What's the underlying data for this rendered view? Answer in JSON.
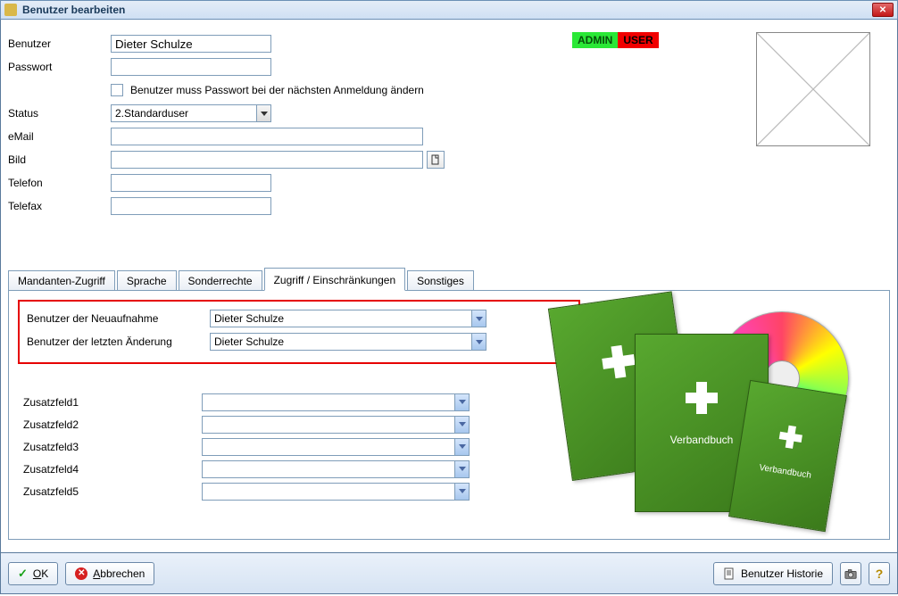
{
  "window": {
    "title": "Benutzer bearbeiten"
  },
  "badges": {
    "admin": "ADMIN",
    "user": "USER"
  },
  "form": {
    "benutzer": {
      "label": "Benutzer",
      "value": "Dieter Schulze"
    },
    "passwort": {
      "label": "Passwort",
      "value": ""
    },
    "force_pw_change": {
      "label": "Benutzer muss Passwort bei der nächsten Anmeldung ändern",
      "checked": false
    },
    "status": {
      "label": "Status",
      "value": "2.Standarduser"
    },
    "email": {
      "label": "eMail",
      "value": ""
    },
    "bild": {
      "label": "Bild",
      "value": ""
    },
    "telefon": {
      "label": "Telefon",
      "value": ""
    },
    "telefax": {
      "label": "Telefax",
      "value": ""
    }
  },
  "tabs": {
    "items": [
      {
        "label": "Mandanten-Zugriff"
      },
      {
        "label": "Sprache"
      },
      {
        "label": "Sonderrechte"
      },
      {
        "label": "Zugriff / Einschränkungen"
      },
      {
        "label": "Sonstiges"
      }
    ],
    "active_index": 3
  },
  "access": {
    "neuaufnahme": {
      "label": "Benutzer der Neuaufnahme",
      "value": "Dieter Schulze"
    },
    "letzte_aenderung": {
      "label": "Benutzer der letzten Änderung",
      "value": "Dieter Schulze"
    },
    "zusatz": [
      {
        "label": "Zusatzfeld1",
        "value": ""
      },
      {
        "label": "Zusatzfeld2",
        "value": ""
      },
      {
        "label": "Zusatzfeld3",
        "value": ""
      },
      {
        "label": "Zusatzfeld4",
        "value": ""
      },
      {
        "label": "Zusatzfeld5",
        "value": ""
      }
    ]
  },
  "product": {
    "book_title": "Verbandbuch"
  },
  "footer": {
    "ok_char": "O",
    "ok_rest": "K",
    "cancel_char": "A",
    "cancel_rest": "bbrechen",
    "history": "Benutzer Historie"
  }
}
